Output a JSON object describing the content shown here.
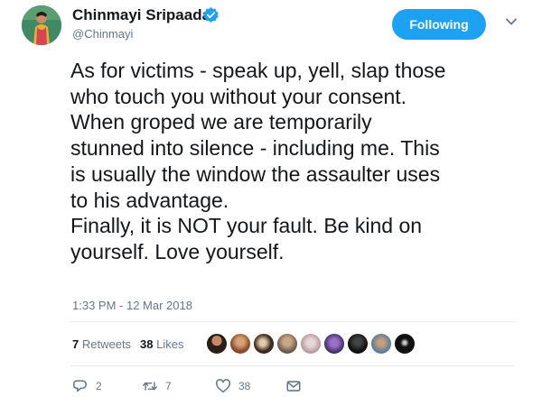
{
  "user": {
    "display_name": "Chinmayi Sripaada",
    "handle": "@Chinmayi",
    "verified": true
  },
  "follow_button": {
    "label": "Following",
    "color": "#1da1f2"
  },
  "tweet": {
    "lines": [
      "As for victims - speak up, yell, slap those",
      "who touch you without your consent.",
      "When groped we are temporarily",
      "stunned into silence - including me. This",
      "is usually the window the assaulter uses",
      "to his advantage.",
      "Finally, it is NOT your fault. Be kind on",
      "yourself. Love yourself."
    ],
    "timestamp": "1:33 PM - 12 Mar 2018"
  },
  "stats": {
    "retweets": {
      "count": "7",
      "label": "Retweets"
    },
    "likes": {
      "count": "38",
      "label": "Likes"
    },
    "liker_avatar_count": 9
  },
  "actions": {
    "reply": {
      "icon": "reply-icon",
      "count": "2"
    },
    "retweet": {
      "icon": "retweet-icon",
      "count": "7"
    },
    "like": {
      "icon": "heart-icon",
      "count": "38"
    },
    "message": {
      "icon": "envelope-icon"
    }
  },
  "colors": {
    "accent": "#1da1f2",
    "text": "#14171a",
    "secondary": "#657786",
    "divider": "#e6ecf0"
  }
}
